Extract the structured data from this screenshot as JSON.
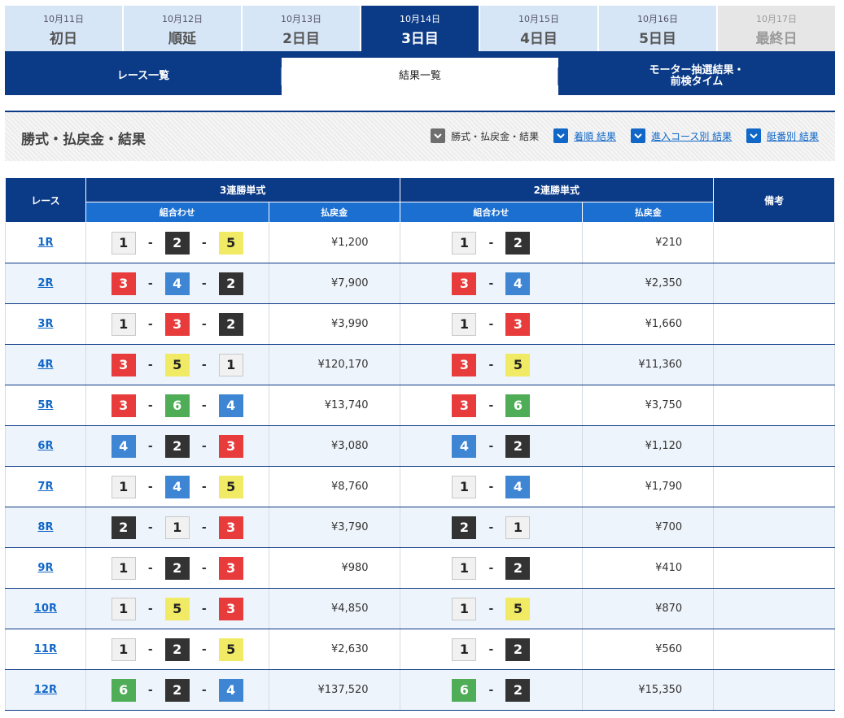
{
  "days": [
    {
      "date": "10月11日",
      "label": "初日"
    },
    {
      "date": "10月12日",
      "label": "順延"
    },
    {
      "date": "10月13日",
      "label": "2日目"
    },
    {
      "date": "10月14日",
      "label": "3日目"
    },
    {
      "date": "10月15日",
      "label": "4日目"
    },
    {
      "date": "10月16日",
      "label": "5日目"
    },
    {
      "date": "10月17日",
      "label": "最終日"
    }
  ],
  "subtabs": [
    {
      "label": "レース一覧"
    },
    {
      "label": "結果一覧"
    },
    {
      "label": "モーター抽選結果・\n前検タイム"
    }
  ],
  "section": {
    "title": "勝式・払戻金・結果",
    "links": [
      {
        "label": "勝式・払戻金・結果"
      },
      {
        "label": "着順 結果"
      },
      {
        "label": "進入コース別 結果"
      },
      {
        "label": "艇番別 結果"
      }
    ]
  },
  "table": {
    "headers": {
      "race": "レース",
      "trifecta": "3連勝単式",
      "exacta": "2連勝単式",
      "note": "備考",
      "combo": "組合わせ",
      "payout": "払戻金"
    },
    "rows": [
      {
        "race": "1R",
        "tri": [
          "1",
          "2",
          "5"
        ],
        "tri_pay": "¥1,200",
        "ex": [
          "1",
          "2"
        ],
        "ex_pay": "¥210"
      },
      {
        "race": "2R",
        "tri": [
          "3",
          "4",
          "2"
        ],
        "tri_pay": "¥7,900",
        "ex": [
          "3",
          "4"
        ],
        "ex_pay": "¥2,350"
      },
      {
        "race": "3R",
        "tri": [
          "1",
          "3",
          "2"
        ],
        "tri_pay": "¥3,990",
        "ex": [
          "1",
          "3"
        ],
        "ex_pay": "¥1,660"
      },
      {
        "race": "4R",
        "tri": [
          "3",
          "5",
          "1"
        ],
        "tri_pay": "¥120,170",
        "ex": [
          "3",
          "5"
        ],
        "ex_pay": "¥11,360"
      },
      {
        "race": "5R",
        "tri": [
          "3",
          "6",
          "4"
        ],
        "tri_pay": "¥13,740",
        "ex": [
          "3",
          "6"
        ],
        "ex_pay": "¥3,750"
      },
      {
        "race": "6R",
        "tri": [
          "4",
          "2",
          "3"
        ],
        "tri_pay": "¥3,080",
        "ex": [
          "4",
          "2"
        ],
        "ex_pay": "¥1,120"
      },
      {
        "race": "7R",
        "tri": [
          "1",
          "4",
          "5"
        ],
        "tri_pay": "¥8,760",
        "ex": [
          "1",
          "4"
        ],
        "ex_pay": "¥1,790"
      },
      {
        "race": "8R",
        "tri": [
          "2",
          "1",
          "3"
        ],
        "tri_pay": "¥3,790",
        "ex": [
          "2",
          "1"
        ],
        "ex_pay": "¥700"
      },
      {
        "race": "9R",
        "tri": [
          "1",
          "2",
          "3"
        ],
        "tri_pay": "¥980",
        "ex": [
          "1",
          "2"
        ],
        "ex_pay": "¥410"
      },
      {
        "race": "10R",
        "tri": [
          "1",
          "5",
          "3"
        ],
        "tri_pay": "¥4,850",
        "ex": [
          "1",
          "5"
        ],
        "ex_pay": "¥870"
      },
      {
        "race": "11R",
        "tri": [
          "1",
          "2",
          "5"
        ],
        "tri_pay": "¥2,630",
        "ex": [
          "1",
          "2"
        ],
        "ex_pay": "¥560"
      },
      {
        "race": "12R",
        "tri": [
          "6",
          "2",
          "4"
        ],
        "tri_pay": "¥137,520",
        "ex": [
          "6",
          "2"
        ],
        "ex_pay": "¥15,350"
      }
    ]
  }
}
